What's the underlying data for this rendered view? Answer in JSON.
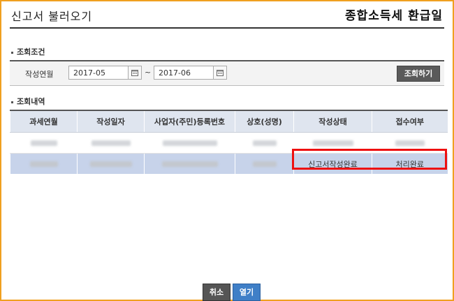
{
  "header": {
    "title": "신고서 불러오기",
    "brand": "종합소득세 환급일"
  },
  "search": {
    "section_label": "조회조건",
    "field_label": "작성연월",
    "start_date": "2017-05",
    "end_date": "2017-06",
    "range_sep": "~",
    "query_button": "조회하기"
  },
  "results": {
    "section_label": "조회내역",
    "columns": [
      "과세연월",
      "작성일자",
      "사업자(주민)등록번호",
      "상호(성명)",
      "작성상태",
      "접수여부"
    ],
    "rows": [
      {
        "status": "",
        "receipt": ""
      },
      {
        "status": "신고서작성완료",
        "receipt": "처리완료"
      }
    ]
  },
  "footer": {
    "cancel": "취소",
    "open": "열기"
  },
  "colors": {
    "frame": "#f0a020",
    "header_bg": "#dfe5ef",
    "selected_row": "#c7d3ea",
    "highlight": "#ee1111",
    "open_button": "#3f7fc7"
  }
}
